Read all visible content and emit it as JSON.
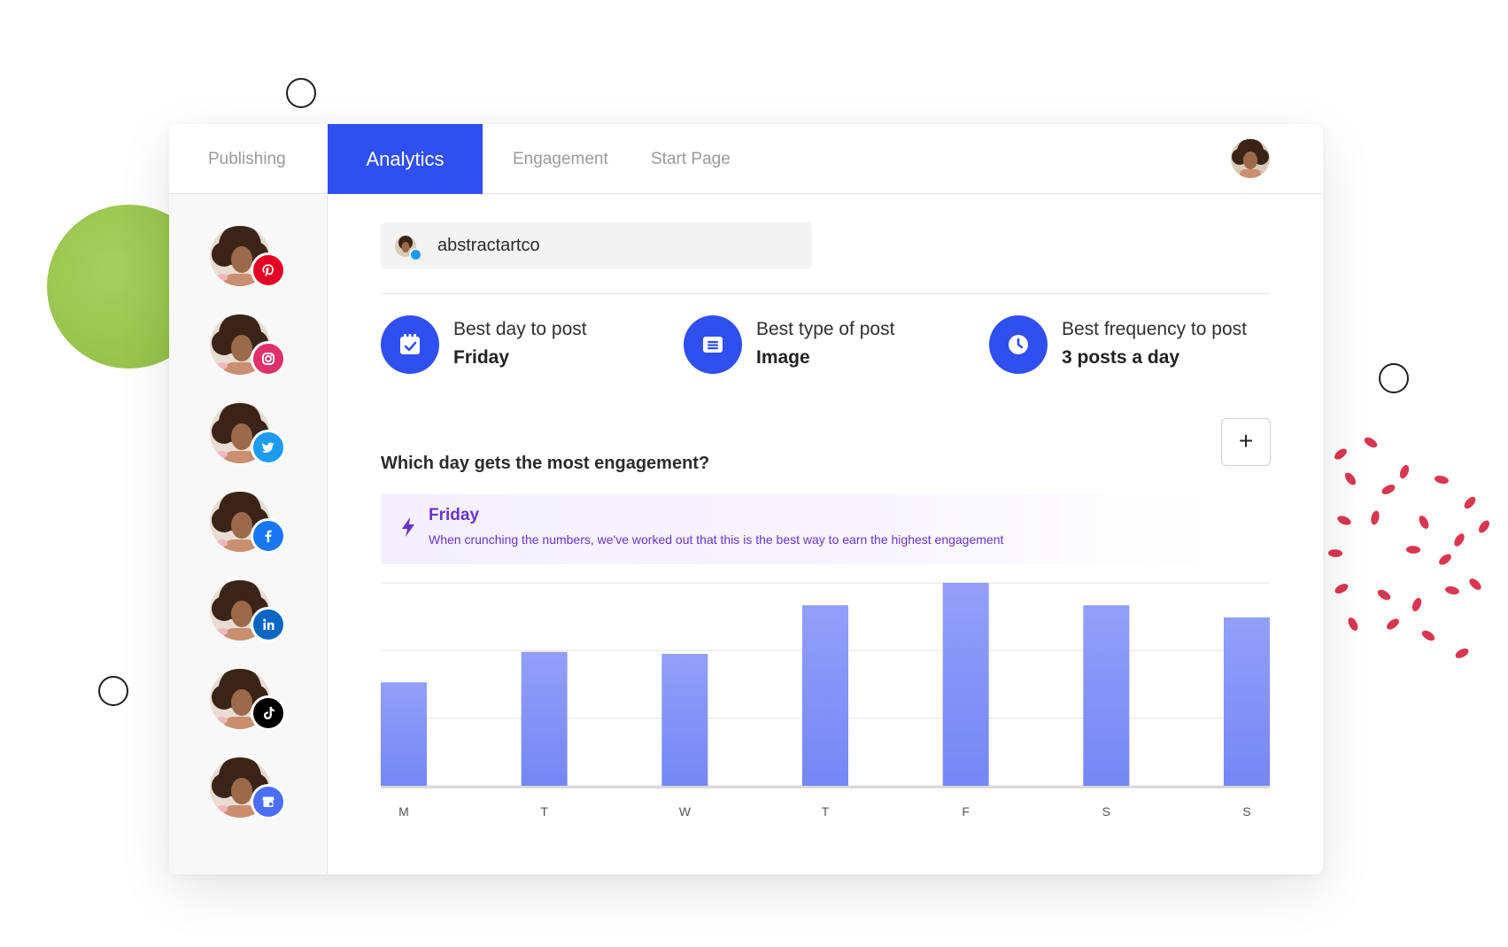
{
  "nav": {
    "tabs": [
      {
        "label": "Publishing",
        "active": false
      },
      {
        "label": "Analytics",
        "active": true
      },
      {
        "label": "Engagement",
        "active": false
      },
      {
        "label": "Start Page",
        "active": false
      }
    ]
  },
  "sidebar": {
    "accounts": [
      {
        "network": "Pinterest",
        "icon": "pinterest-icon",
        "color": "#e60023"
      },
      {
        "network": "Instagram",
        "icon": "instagram-icon",
        "color": "#e1306c"
      },
      {
        "network": "Twitter",
        "icon": "twitter-icon",
        "color": "#1d9bf0"
      },
      {
        "network": "Facebook",
        "icon": "facebook-icon",
        "color": "#1877f2"
      },
      {
        "network": "LinkedIn",
        "icon": "linkedin-icon",
        "color": "#0a66c2"
      },
      {
        "network": "TikTok",
        "icon": "tiktok-icon",
        "color": "#000000"
      },
      {
        "network": "Google Business",
        "icon": "store-icon",
        "color": "#4a6ef5"
      }
    ]
  },
  "account_selector": {
    "name": "abstractartco"
  },
  "stats": [
    {
      "label": "Best day to post",
      "value": "Friday",
      "icon": "calendar-icon"
    },
    {
      "label": "Best type of post",
      "value": "Image",
      "icon": "post-type-icon"
    },
    {
      "label": "Best frequency to post",
      "value": "3 posts a day",
      "icon": "clock-icon"
    }
  ],
  "section": {
    "question": "Which day gets the most engagement?",
    "add_label": "+"
  },
  "insight": {
    "title": "Friday",
    "description": "When crunching the numbers, we've worked out that this is the best way to earn the highest engagement"
  },
  "colors": {
    "accent": "#2f4ff1",
    "bar_top": "#939ff8",
    "bar_bottom": "#7587f6",
    "insight_text": "#6b32c8"
  },
  "chart_data": {
    "type": "bar",
    "categories": [
      "M",
      "T",
      "W",
      "T",
      "F",
      "S",
      "S"
    ],
    "values": [
      51,
      66,
      65,
      89,
      100,
      89,
      83
    ],
    "ylim": [
      0,
      100
    ],
    "grid": true,
    "title": "",
    "xlabel": "",
    "ylabel": ""
  }
}
